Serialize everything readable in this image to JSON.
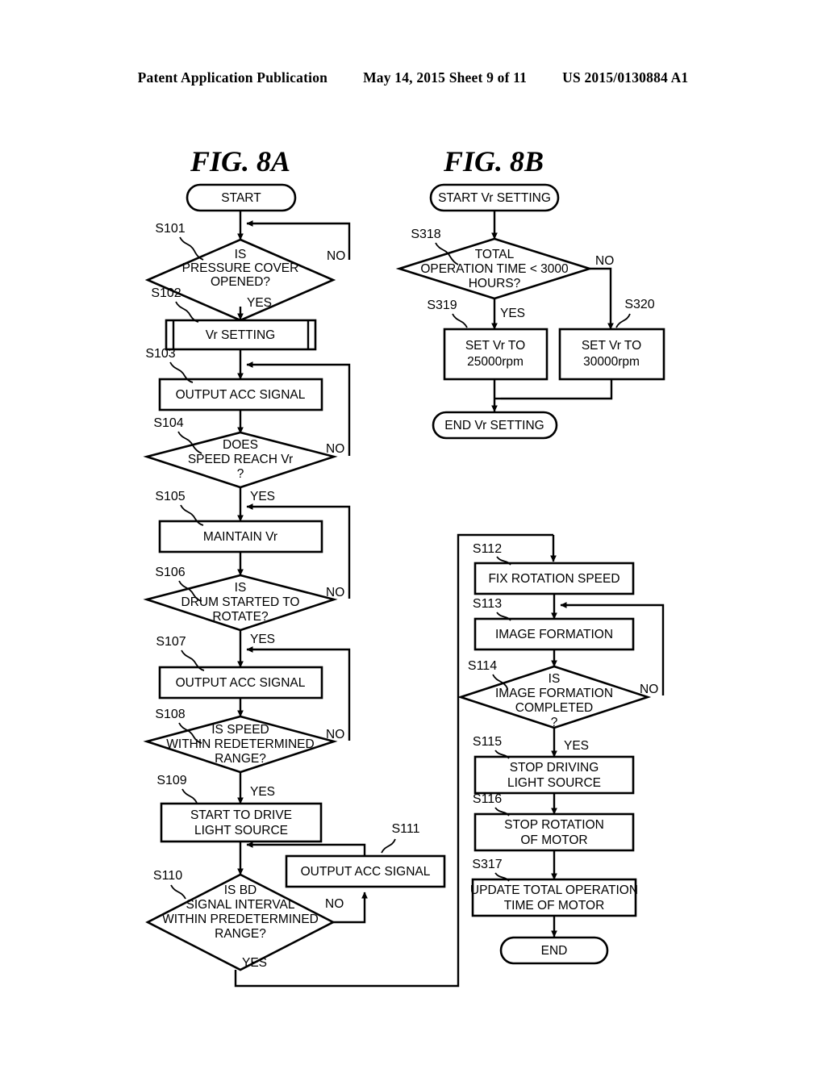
{
  "header": {
    "publication": "Patent Application Publication",
    "date_sheet": "May 14, 2015  Sheet 9 of 11",
    "patent_number": "US 2015/0130884 A1"
  },
  "figures": {
    "fig_a": {
      "title": "FIG. 8A",
      "nodes": {
        "start": "START",
        "s101": {
          "label": "S101",
          "line1": "IS",
          "line2": "PRESSURE COVER",
          "line3": "OPENED?"
        },
        "s102": {
          "label": "S102",
          "line1": "Vr SETTING"
        },
        "s103": {
          "label": "S103",
          "line1": "OUTPUT ACC SIGNAL"
        },
        "s104": {
          "label": "S104",
          "line1": "DOES",
          "line2": "SPEED REACH Vr",
          "line3": "?"
        },
        "s105": {
          "label": "S105",
          "line1": "MAINTAIN Vr"
        },
        "s106": {
          "label": "S106",
          "line1": "IS",
          "line2": "DRUM STARTED TO",
          "line3": "ROTATE?"
        },
        "s107": {
          "label": "S107",
          "line1": "OUTPUT ACC SIGNAL"
        },
        "s108": {
          "label": "S108",
          "line1": "IS SPEED",
          "line2": "WITHIN REDETERMINED",
          "line3": "RANGE?"
        },
        "s109": {
          "label": "S109",
          "line1": "START TO DRIVE",
          "line2": "LIGHT SOURCE"
        },
        "s110": {
          "label": "S110",
          "line1": "IS BD",
          "line2": "SIGNAL INTERVAL",
          "line3": "WITHIN PREDETERMINED",
          "line4": "RANGE?"
        },
        "s111": {
          "label": "S111",
          "line1": "OUTPUT ACC SIGNAL"
        }
      },
      "branch_labels": {
        "no": "NO",
        "yes": "YES"
      }
    },
    "fig_b": {
      "title": "FIG. 8B",
      "nodes": {
        "start": "START Vr SETTING",
        "s318": {
          "label": "S318",
          "line1": "TOTAL",
          "line2": "OPERATION TIME < 3000",
          "line3": "HOURS?"
        },
        "s319": {
          "label": "S319",
          "line1": "SET Vr TO",
          "line2": "25000rpm"
        },
        "s320": {
          "label": "S320",
          "line1": "SET Vr TO",
          "line2": "30000rpm"
        },
        "end": "END Vr SETTING"
      },
      "branch_labels": {
        "no": "NO",
        "yes": "YES"
      }
    },
    "fig_a_cont": {
      "nodes": {
        "s112": {
          "label": "S112",
          "line1": "FIX ROTATION SPEED"
        },
        "s113": {
          "label": "S113",
          "line1": "IMAGE FORMATION"
        },
        "s114": {
          "label": "S114",
          "line1": "IS",
          "line2": "IMAGE FORMATION",
          "line3": "COMPLETED",
          "line4": "?"
        },
        "s115": {
          "label": "S115",
          "line1": "STOP DRIVING",
          "line2": "LIGHT SOURCE"
        },
        "s116": {
          "label": "S116",
          "line1": "STOP ROTATION",
          "line2": "OF MOTOR"
        },
        "s317": {
          "label": "S317",
          "line1": "UPDATE TOTAL OPERATION",
          "line2": "TIME OF MOTOR"
        },
        "end": "END"
      },
      "branch_labels": {
        "no": "NO",
        "yes": "YES"
      }
    }
  },
  "colors": {
    "ink": "#000000",
    "paper": "#ffffff"
  }
}
